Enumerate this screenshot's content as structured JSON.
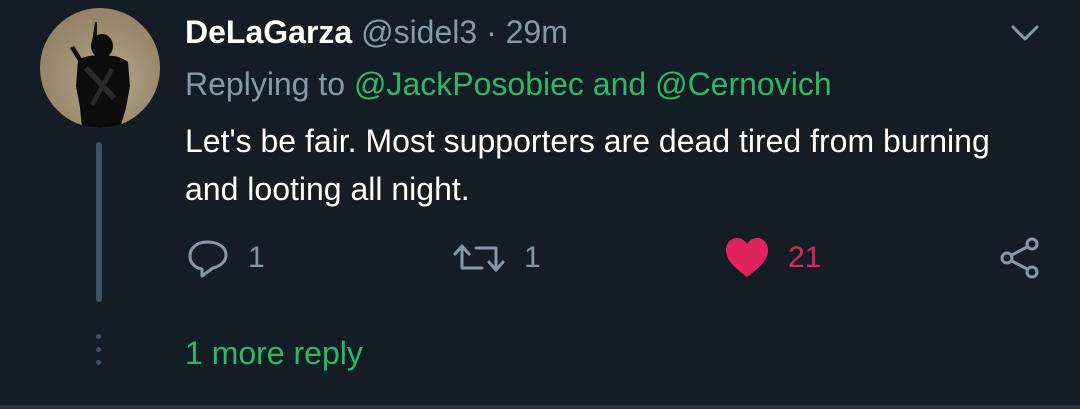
{
  "tweet": {
    "display_name": "DeLaGarza",
    "handle": "@sidel3",
    "separator": "·",
    "time": "29m",
    "replying_prefix": "Replying to",
    "mention_1": "@JackPosobiec",
    "mention_joiner": "and",
    "mention_2": "@Cernovich",
    "text": "Let's be fair. Most supporters are dead tired from burning and looting all night.",
    "actions": {
      "reply_count": "1",
      "retweet_count": "1",
      "like_count": "21"
    },
    "more_replies": "1 more reply"
  },
  "icons": [
    "chevron-down-icon",
    "reply-icon",
    "retweet-icon",
    "heart-icon",
    "share-icon"
  ],
  "colors": {
    "background": "#141d26",
    "secondary_text": "#8899a6",
    "accent_green": "#2fb864",
    "like_red": "#e0245e",
    "thread_line": "#3e5366"
  }
}
